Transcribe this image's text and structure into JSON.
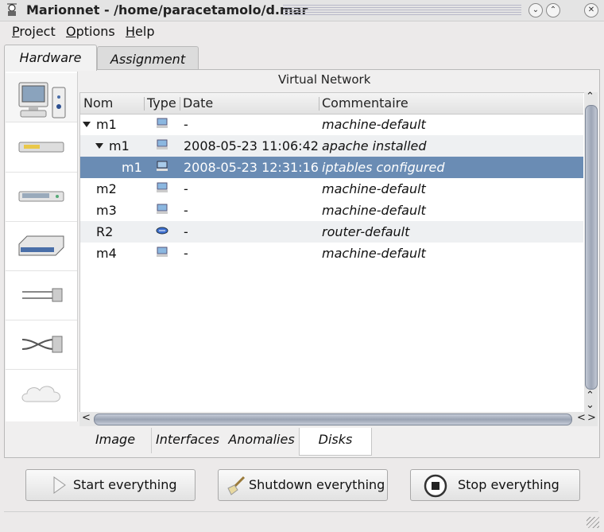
{
  "window": {
    "title": "Marionnet - /home/paracetamolo/d.mar",
    "controls": [
      "minimize-icon",
      "maximize-icon",
      "close-icon"
    ]
  },
  "menu": [
    {
      "label": "Project",
      "mnemonic": "P"
    },
    {
      "label": "Options",
      "mnemonic": "O"
    },
    {
      "label": "Help",
      "mnemonic": "H"
    }
  ],
  "tabs": {
    "hardware": "Hardware",
    "assignment": "Assignment",
    "selected": "Hardware"
  },
  "palette": [
    {
      "name": "machine-icon"
    },
    {
      "name": "hub-icon"
    },
    {
      "name": "switch-icon"
    },
    {
      "name": "router-icon"
    },
    {
      "name": "straight-cable-icon"
    },
    {
      "name": "crossover-cable-icon"
    },
    {
      "name": "cloud-icon"
    }
  ],
  "network": {
    "label": "Virtual Network",
    "columns": {
      "name": "Nom",
      "type": "Type",
      "date": "Date",
      "comment": "Commentaire"
    },
    "rows": [
      {
        "name": "m1",
        "type": "machine",
        "date": "-",
        "comment": "machine-default",
        "expanded": true
      },
      {
        "name": "m1",
        "type": "machine",
        "date": "2008-05-23 11:06:42",
        "comment": "apache installed",
        "expanded": true
      },
      {
        "name": "m1",
        "type": "machine",
        "date": "2008-05-23 12:31:16",
        "comment": "iptables configured",
        "selected": true
      },
      {
        "name": "m2",
        "type": "machine",
        "date": "-",
        "comment": "machine-default"
      },
      {
        "name": "m3",
        "type": "machine",
        "date": "-",
        "comment": "machine-default"
      },
      {
        "name": "R2",
        "type": "router",
        "date": "-",
        "comment": "router-default"
      },
      {
        "name": "m4",
        "type": "machine",
        "date": "-",
        "comment": "machine-default"
      }
    ]
  },
  "bottom_tabs": {
    "image": "Image",
    "interfaces": "Interfaces",
    "anomalies": "Anomalies",
    "disks": "Disks",
    "selected": "Disks"
  },
  "actions": {
    "start": "Start everything",
    "shutdown": "Shutdown everything",
    "stop": "Stop everything"
  },
  "colors": {
    "selection": "#6a8cb4",
    "alt_row": "#eef0f2"
  }
}
